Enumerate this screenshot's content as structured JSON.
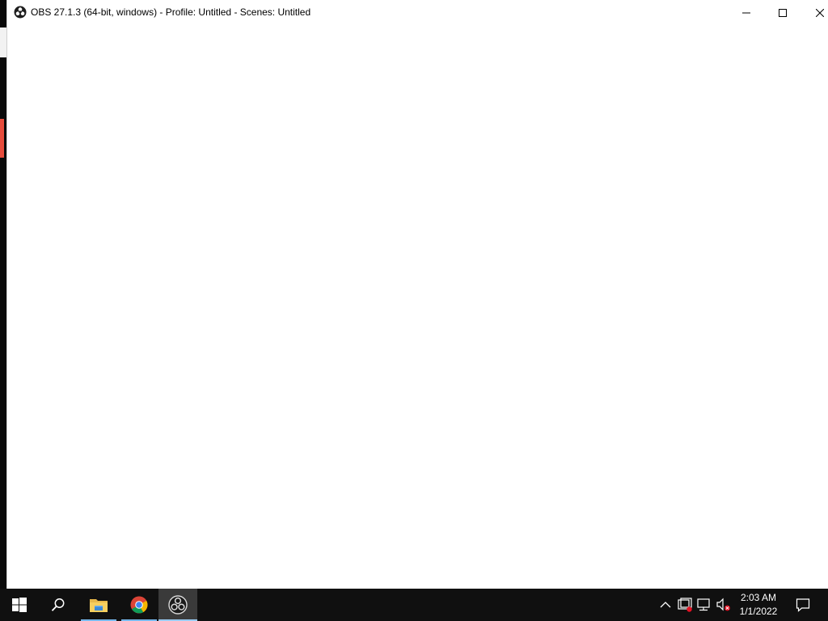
{
  "window": {
    "title": "OBS 27.1.3 (64-bit, windows) - Profile: Untitled - Scenes: Untitled",
    "icon": "obs-icon",
    "controls": [
      "minimize-icon",
      "maximize-icon",
      "close-icon"
    ]
  },
  "taskbar": {
    "items": [
      {
        "name": "start-button",
        "icon": "windows-logo-icon"
      },
      {
        "name": "search-button",
        "icon": "search-icon"
      },
      {
        "name": "file-explorer",
        "icon": "folder-icon"
      },
      {
        "name": "google-chrome",
        "icon": "chrome-icon"
      },
      {
        "name": "obs-studio",
        "icon": "obs-icon"
      }
    ],
    "tray": {
      "icons": [
        "chevron-up-icon",
        "app-tray-icon",
        "network-icon",
        "volume-muted-icon"
      ],
      "time": "2:03 AM",
      "date": "1/1/2022",
      "notification_icon": "action-center-icon"
    }
  },
  "colors": {
    "taskbar_bg": "#101010",
    "active_indicator": "#99ccf3",
    "window_bg": "#ffffff"
  }
}
